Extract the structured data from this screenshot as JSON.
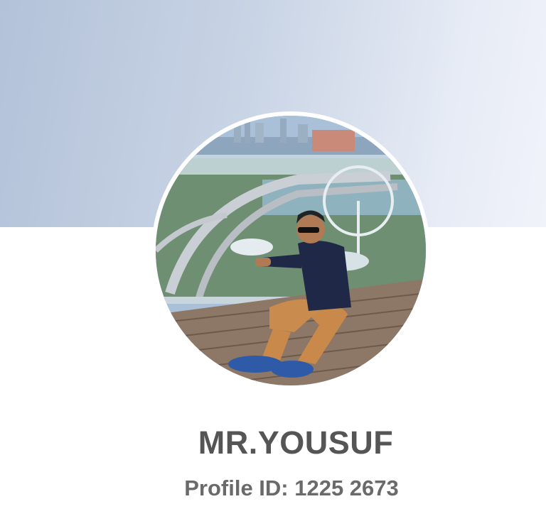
{
  "profile": {
    "name": "MR.YOUSUF",
    "id_text": "Profile ID: 1225 2673"
  },
  "colors": {
    "cover_start": "#b3c2d9",
    "cover_end": "#f1f3fa",
    "name_text": "#555555",
    "id_text": "#6a6a6a"
  }
}
